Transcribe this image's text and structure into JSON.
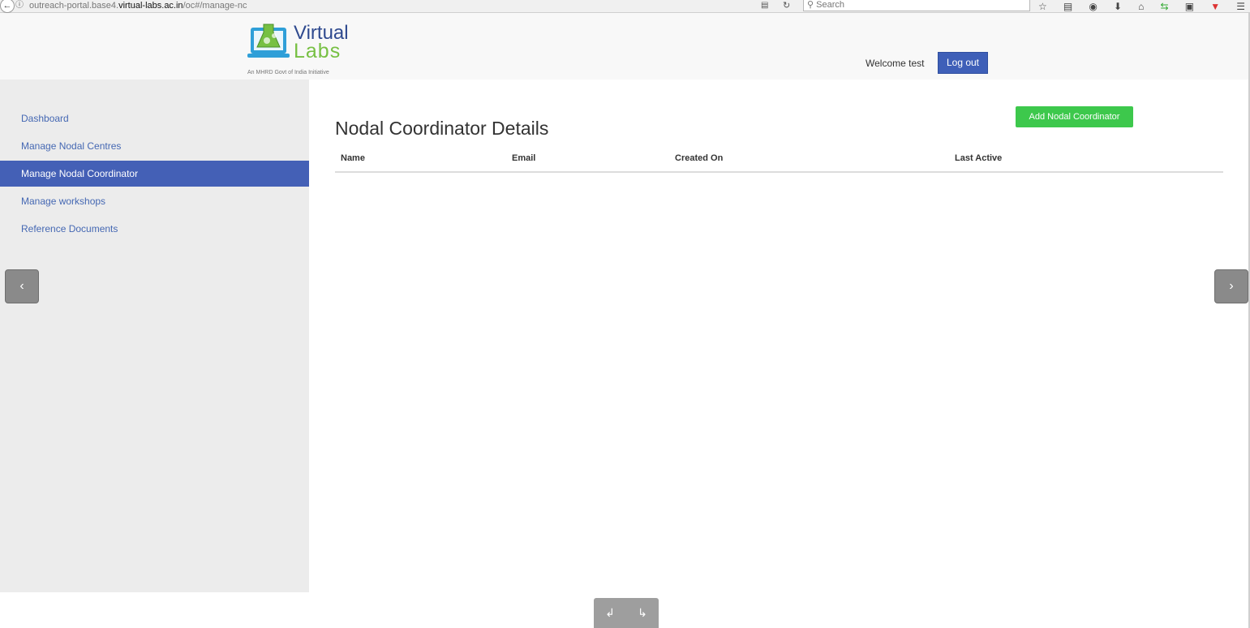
{
  "browser": {
    "url_prefix": "outreach-portal.base4.",
    "url_domain": "virtual-labs.ac.in",
    "url_suffix": "/oc#/manage-nc",
    "search_placeholder": "Search",
    "icons": [
      "star-icon",
      "clipboard-icon",
      "pocket-icon",
      "download-icon",
      "home-icon",
      "sync-icon",
      "screenshot-icon",
      "shield-icon",
      "menu-icon"
    ]
  },
  "header": {
    "logo_brand_line1": "Virtual",
    "logo_brand_line2": "Labs",
    "logo_tagline": "An MHRD Govt of India Initiative",
    "welcome_text": "Welcome test",
    "logout_label": "Log out"
  },
  "sidebar": {
    "items": [
      {
        "label": "Dashboard",
        "active": false
      },
      {
        "label": "Manage Nodal Centres",
        "active": false
      },
      {
        "label": "Manage Nodal Coordinator",
        "active": true
      },
      {
        "label": "Manage workshops",
        "active": false
      },
      {
        "label": "Reference Documents",
        "active": false
      }
    ]
  },
  "main": {
    "title": "Nodal Coordinator Details",
    "add_button_label": "Add Nodal Coordinator",
    "table": {
      "columns": [
        "Name",
        "Email",
        "Created On",
        "Last Active"
      ],
      "rows": []
    }
  },
  "colors": {
    "active_nav": "#4460b6",
    "link": "#4568b3",
    "add_button": "#3dc84c",
    "logout_button": "#3e5fb8"
  }
}
